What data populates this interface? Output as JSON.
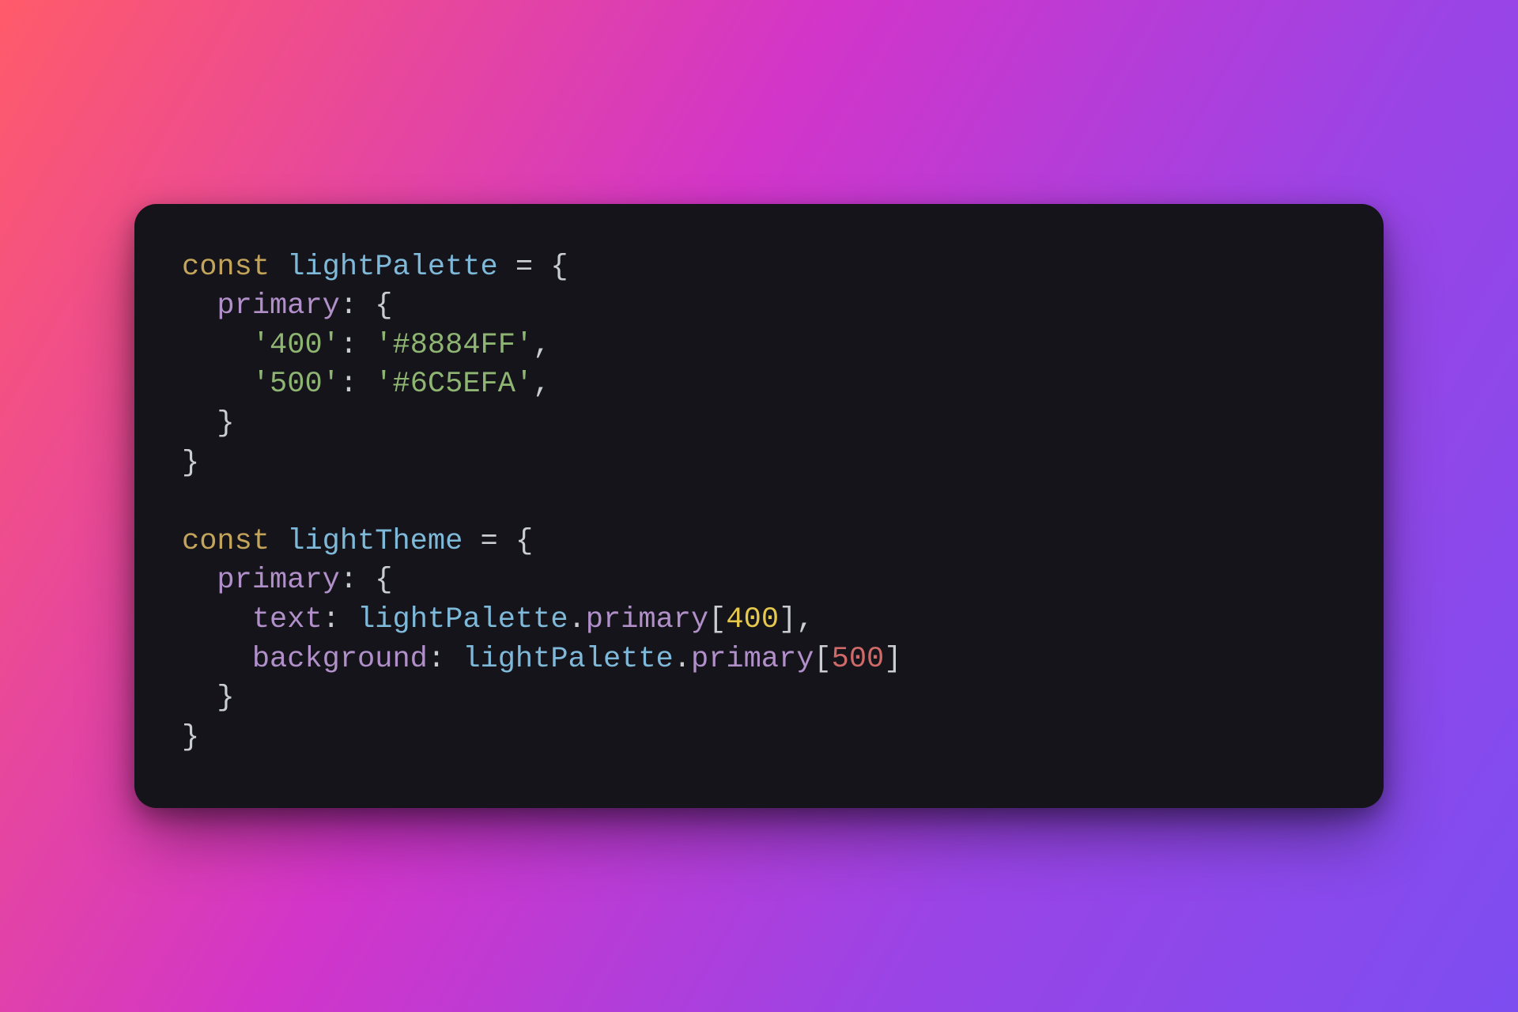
{
  "code": {
    "declarations": [
      {
        "keyword": "const",
        "name": "lightPalette",
        "equals": "=",
        "open": "{",
        "props": [
          {
            "key": "primary",
            "colon": ":",
            "open": "{",
            "entries": [
              {
                "key_string": "'400'",
                "colon": ":",
                "value_string": "'#8884FF'",
                "comma": ","
              },
              {
                "key_string": "'500'",
                "colon": ":",
                "value_string": "'#6C5EFA'",
                "comma": ","
              }
            ],
            "close": "}"
          }
        ],
        "close": "}"
      },
      {
        "keyword": "const",
        "name": "lightTheme",
        "equals": "=",
        "open": "{",
        "props": [
          {
            "key": "primary",
            "colon": ":",
            "open": "{",
            "ref_entries": [
              {
                "key": "text",
                "colon": ":",
                "ref_obj": "lightPalette",
                "dot": ".",
                "ref_prop": "primary",
                "lbracket": "[",
                "index": "400",
                "index_style": "yellow",
                "rbracket": "]",
                "comma": ","
              },
              {
                "key": "background",
                "colon": ":",
                "ref_obj": "lightPalette",
                "dot": ".",
                "ref_prop": "primary",
                "lbracket": "[",
                "index": "500",
                "index_style": "red",
                "rbracket": "]",
                "comma": ""
              }
            ],
            "close": "}"
          }
        ],
        "close": "}"
      }
    ],
    "space": " ",
    "indent2": "  ",
    "indent4": "    "
  },
  "colors": {
    "card_bg": "#14141a",
    "gradient_start": "#ff5b6a",
    "gradient_mid1": "#d235c9",
    "gradient_mid2": "#9a44e6",
    "gradient_end": "#7d4df0"
  }
}
